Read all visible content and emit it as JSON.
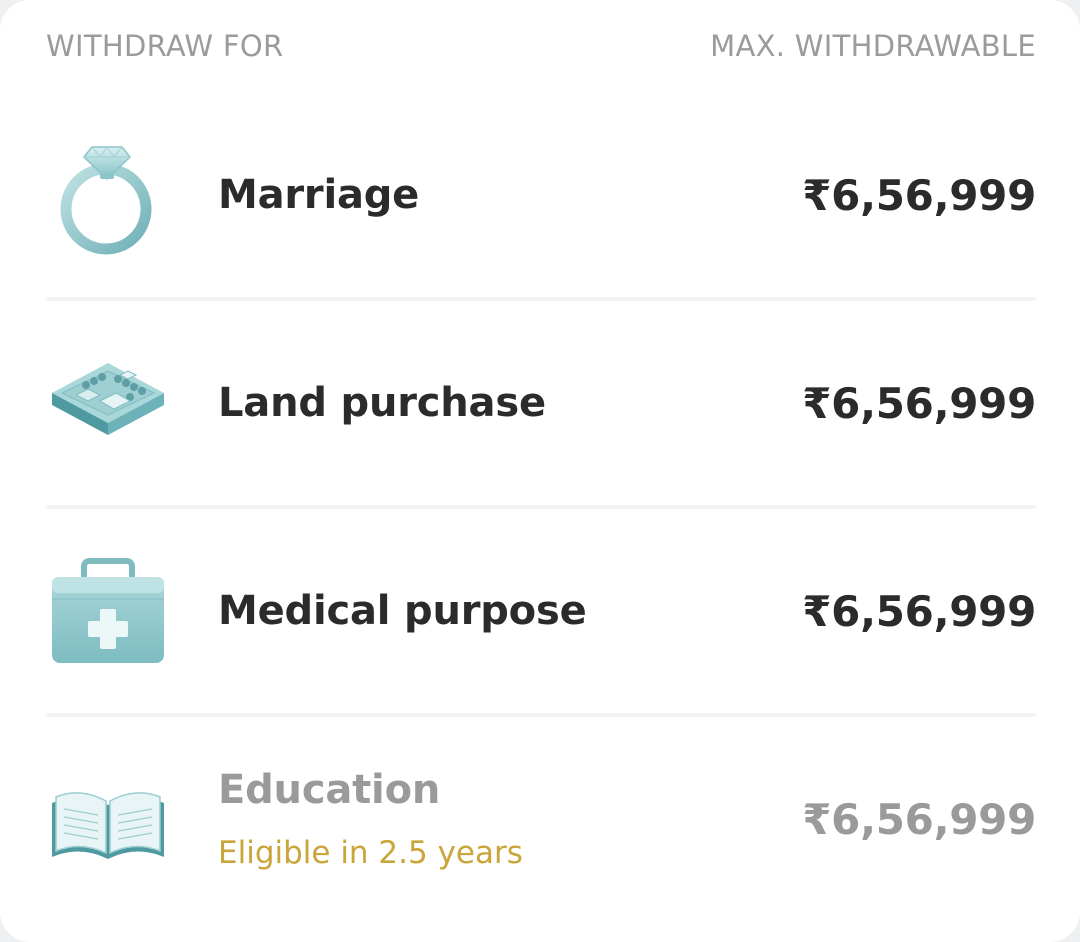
{
  "header": {
    "left_label": "WITHDRAW FOR",
    "right_label": "MAX. WITHDRAWABLE"
  },
  "rows": [
    {
      "icon": "ring-icon",
      "label": "Marriage",
      "amount": "₹6,56,999",
      "enabled": true
    },
    {
      "icon": "land-plot-icon",
      "label": "Land purchase",
      "amount": "₹6,56,999",
      "enabled": true
    },
    {
      "icon": "medical-kit-icon",
      "label": "Medical purpose",
      "amount": "₹6,56,999",
      "enabled": true
    },
    {
      "icon": "open-book-icon",
      "label": "Education",
      "sublabel": "Eligible in 2.5 years",
      "amount": "₹6,56,999",
      "enabled": false
    }
  ],
  "colors": {
    "icon_teal": "#8fc7cc",
    "eligible_gold": "#c9a53a",
    "disabled_gray": "#9a9a9a"
  }
}
